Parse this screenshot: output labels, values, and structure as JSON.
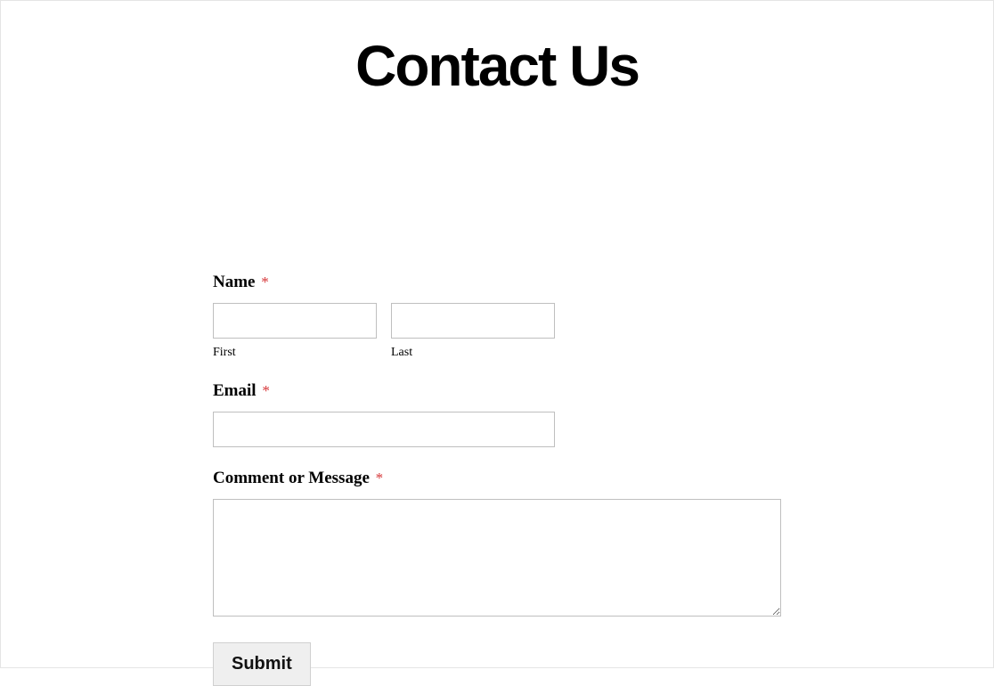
{
  "header": {
    "title": "Contact Us"
  },
  "form": {
    "name": {
      "label": "Name",
      "required_mark": "*",
      "first_sublabel": "First",
      "last_sublabel": "Last",
      "first_value": "",
      "last_value": ""
    },
    "email": {
      "label": "Email",
      "required_mark": "*",
      "value": ""
    },
    "message": {
      "label": "Comment or Message",
      "required_mark": "*",
      "value": ""
    },
    "submit": {
      "label": "Submit"
    }
  }
}
